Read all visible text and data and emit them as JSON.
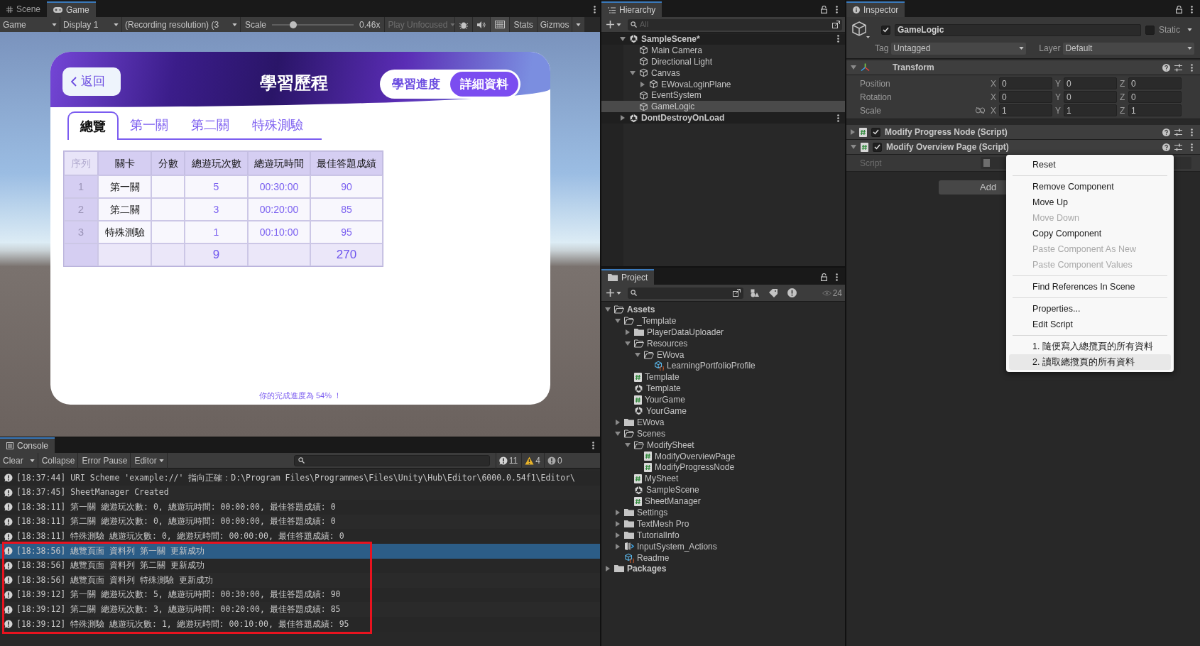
{
  "game_panel": {
    "tabs": [
      {
        "label": "Scene",
        "kind": "scene",
        "selected": false
      },
      {
        "label": "Game",
        "kind": "game",
        "selected": true
      }
    ],
    "toolbar": {
      "display_mode": "Game",
      "display": "Display 1",
      "resolution": "(Recording resolution) (3",
      "scale_label": "Scale",
      "scale": {
        "level": 0.26
      },
      "scale_value": "0.46x",
      "play_mode": "Play Unfocused",
      "stats": "Stats",
      "gizmos": "Gizmos"
    }
  },
  "game": {
    "back": "返回",
    "title": "學習歷程",
    "view_tabs": [
      {
        "label": "學習進度",
        "selected": false
      },
      {
        "label": "詳細資料",
        "selected": true
      }
    ],
    "tabs": [
      {
        "label": "總覽",
        "selected": true
      },
      {
        "label": "第一關",
        "selected": false
      },
      {
        "label": "第二關",
        "selected": false
      },
      {
        "label": "特殊測驗",
        "selected": false
      }
    ],
    "table": {
      "columns": [
        {
          "label": "序列",
          "kind": "index"
        },
        {
          "label": "關卡",
          "kind": "stage"
        },
        {
          "label": "分數",
          "kind": "score"
        },
        {
          "label": "總遊玩次數",
          "kind": "count"
        },
        {
          "label": "總遊玩時間",
          "kind": "time"
        },
        {
          "label": "最佳答題成績",
          "kind": "best"
        }
      ],
      "rows": [
        {
          "index": "1",
          "stage": "第一關",
          "count": "5",
          "time": "00:30:00",
          "best": "90"
        },
        {
          "index": "2",
          "stage": "第二關",
          "count": "3",
          "time": "00:20:00",
          "best": "85"
        },
        {
          "index": "3",
          "stage": "特殊測驗",
          "count": "1",
          "time": "00:10:00",
          "best": "95"
        }
      ],
      "totals": {
        "count": "9",
        "best": "270"
      }
    },
    "footer": "你的完成進度為 54% ！"
  },
  "console": {
    "title": "Console",
    "toolbar": [
      {
        "label": "Clear",
        "kind": "split"
      },
      {
        "label": "Collapse",
        "kind": "toggle"
      },
      {
        "label": "Error Pause",
        "kind": "toggle"
      },
      {
        "label": "Editor",
        "kind": "dropdown"
      }
    ],
    "counts": [
      {
        "kind": "info",
        "label": "11"
      },
      {
        "kind": "warning",
        "label": "4"
      },
      {
        "kind": "error",
        "label": "0"
      }
    ],
    "rows": [
      {
        "text": "[18:37:44] URI Scheme 'example://' 指向正確：D:\\Program Files\\Programmes\\Files\\Unity\\Hub\\Editor\\6000.0.54f1\\Editor\\",
        "selected": false,
        "boxed": false
      },
      {
        "text": "[18:37:45] SheetManager Created",
        "selected": false,
        "boxed": false
      },
      {
        "text": "[18:38:11] 第一關 總遊玩次數: 0, 總遊玩時間: 00:00:00, 最佳答題成績: 0",
        "selected": false,
        "boxed": false
      },
      {
        "text": "[18:38:11] 第二關 總遊玩次數: 0, 總遊玩時間: 00:00:00, 最佳答題成績: 0",
        "selected": false,
        "boxed": false
      },
      {
        "text": "[18:38:11] 特殊測驗 總遊玩次數: 0, 總遊玩時間: 00:00:00, 最佳答題成績: 0",
        "selected": false,
        "boxed": false
      },
      {
        "text": "[18:38:56] 總覽頁面 資料列 第一關 更新成功",
        "selected": true,
        "boxed": true
      },
      {
        "text": "[18:38:56] 總覽頁面 資料列 第二關 更新成功",
        "selected": false,
        "boxed": true
      },
      {
        "text": "[18:38:56] 總覽頁面 資料列 特殊測驗 更新成功",
        "selected": false,
        "boxed": true
      },
      {
        "text": "[18:39:12] 第一關 總遊玩次數: 5, 總遊玩時間: 00:30:00, 最佳答題成績: 90",
        "selected": false,
        "boxed": true
      },
      {
        "text": "[18:39:12] 第二關 總遊玩次數: 3, 總遊玩時間: 00:20:00, 最佳答題成績: 85",
        "selected": false,
        "boxed": true
      },
      {
        "text": "[18:39:12] 特殊測驗 總遊玩次數: 1, 總遊玩時間: 00:10:00, 最佳答題成績: 95",
        "selected": false,
        "boxed": true
      }
    ]
  },
  "hierarchy": {
    "title": "Hierarchy",
    "search_placeholder": "All",
    "items": [
      {
        "label": "SampleScene*",
        "kind": "scene",
        "expanded": true,
        "selected": false,
        "children": [
          {
            "label": "Main Camera",
            "kind": "object",
            "selected": false
          },
          {
            "label": "Directional Light",
            "kind": "object",
            "selected": false
          },
          {
            "label": "Canvas",
            "kind": "object",
            "expanded": true,
            "selected": false,
            "children": [
              {
                "label": "EWovaLoginPlane",
                "kind": "object",
                "expanded": false,
                "selected": false
              }
            ]
          },
          {
            "label": "EventSystem",
            "kind": "object",
            "selected": false
          },
          {
            "label": "GameLogic",
            "kind": "object",
            "selected": true
          }
        ]
      },
      {
        "label": "DontDestroyOnLoad",
        "kind": "scene",
        "expanded": false,
        "selected": false
      }
    ]
  },
  "project": {
    "title": "Project",
    "hidden_count": "24",
    "items": [
      {
        "label": "Assets",
        "kind": "folder",
        "expanded": true,
        "children": [
          {
            "label": "_Template",
            "kind": "folder",
            "expanded": true,
            "children": [
              {
                "label": "PlayerDataUploader",
                "kind": "folder",
                "expanded": false
              },
              {
                "label": "Resources",
                "kind": "folder",
                "expanded": true,
                "children": [
                  {
                    "label": "EWova",
                    "kind": "folder",
                    "expanded": true,
                    "children": [
                      {
                        "label": "LearningPortfolioProfile",
                        "kind": "asset"
                      }
                    ]
                  }
                ]
              },
              {
                "label": "Template",
                "kind": "script"
              },
              {
                "label": "Template",
                "kind": "scene"
              },
              {
                "label": "YourGame",
                "kind": "script"
              },
              {
                "label": "YourGame",
                "kind": "scene"
              }
            ]
          },
          {
            "label": "EWova",
            "kind": "folder",
            "expanded": false
          },
          {
            "label": "Scenes",
            "kind": "folder",
            "expanded": true,
            "children": [
              {
                "label": "ModifySheet",
                "kind": "folder",
                "expanded": true,
                "children": [
                  {
                    "label": "ModifyOverviewPage",
                    "kind": "script"
                  },
                  {
                    "label": "ModifyProgressNode",
                    "kind": "script"
                  }
                ]
              },
              {
                "label": "MySheet",
                "kind": "script"
              },
              {
                "label": "SampleScene",
                "kind": "scene"
              },
              {
                "label": "SheetManager",
                "kind": "script"
              }
            ]
          },
          {
            "label": "Settings",
            "kind": "folder",
            "expanded": false
          },
          {
            "label": "TextMesh Pro",
            "kind": "folder",
            "expanded": false
          },
          {
            "label": "TutorialInfo",
            "kind": "folder",
            "expanded": false
          },
          {
            "label": "InputSystem_Actions",
            "kind": "input",
            "expanded": false
          },
          {
            "label": "Readme",
            "kind": "asset"
          }
        ]
      },
      {
        "label": "Packages",
        "kind": "folder",
        "expanded": false
      }
    ]
  },
  "inspector": {
    "title": "Inspector",
    "object": {
      "name": "GameLogic",
      "active": true,
      "static": false,
      "static_label": "Static",
      "tag_label": "Tag",
      "tag": "Untagged",
      "layer_label": "Layer",
      "layer": "Default"
    },
    "transform": {
      "title": "Transform",
      "expanded": true,
      "rows": [
        {
          "label": "Position",
          "fields": [
            {
              "axis": "X",
              "value": "0"
            },
            {
              "axis": "Y",
              "value": "0"
            },
            {
              "axis": "Z",
              "value": "0"
            }
          ]
        },
        {
          "label": "Rotation",
          "fields": [
            {
              "axis": "X",
              "value": "0"
            },
            {
              "axis": "Y",
              "value": "0"
            },
            {
              "axis": "Z",
              "value": "0"
            }
          ]
        },
        {
          "label": "Scale",
          "proportional": false,
          "fields": [
            {
              "axis": "X",
              "value": "1"
            },
            {
              "axis": "Y",
              "value": "1"
            },
            {
              "axis": "Z",
              "value": "1"
            }
          ]
        }
      ]
    },
    "components": [
      {
        "title": "Modify Progress Node (Script)",
        "enabled": true,
        "expanded": false
      },
      {
        "title": "Modify Overview Page (Script)",
        "enabled": true,
        "expanded": true,
        "field_label": "Script"
      }
    ],
    "add_button": "Add",
    "context_menu": [
      {
        "kind": "item",
        "label": "Reset",
        "disabled": false,
        "selected": false
      },
      {
        "kind": "separator"
      },
      {
        "kind": "item",
        "label": "Remove Component",
        "disabled": false,
        "selected": false
      },
      {
        "kind": "item",
        "label": "Move Up",
        "disabled": false,
        "selected": false
      },
      {
        "kind": "item",
        "label": "Move Down",
        "disabled": true,
        "selected": false
      },
      {
        "kind": "item",
        "label": "Copy Component",
        "disabled": false,
        "selected": false
      },
      {
        "kind": "item",
        "label": "Paste Component As New",
        "disabled": true,
        "selected": false
      },
      {
        "kind": "item",
        "label": "Paste Component Values",
        "disabled": true,
        "selected": false
      },
      {
        "kind": "separator"
      },
      {
        "kind": "item",
        "label": "Find References In Scene",
        "disabled": false,
        "selected": false
      },
      {
        "kind": "separator"
      },
      {
        "kind": "item",
        "label": "Properties...",
        "disabled": false,
        "selected": false
      },
      {
        "kind": "item",
        "label": "Edit Script",
        "disabled": false,
        "selected": false
      },
      {
        "kind": "separator"
      },
      {
        "kind": "item",
        "label": "1. 隨便寫入總攬頁的所有資料",
        "disabled": false,
        "selected": false
      },
      {
        "kind": "item",
        "label": "2. 讀取總攬頁的所有資料",
        "disabled": false,
        "selected": true
      }
    ]
  }
}
